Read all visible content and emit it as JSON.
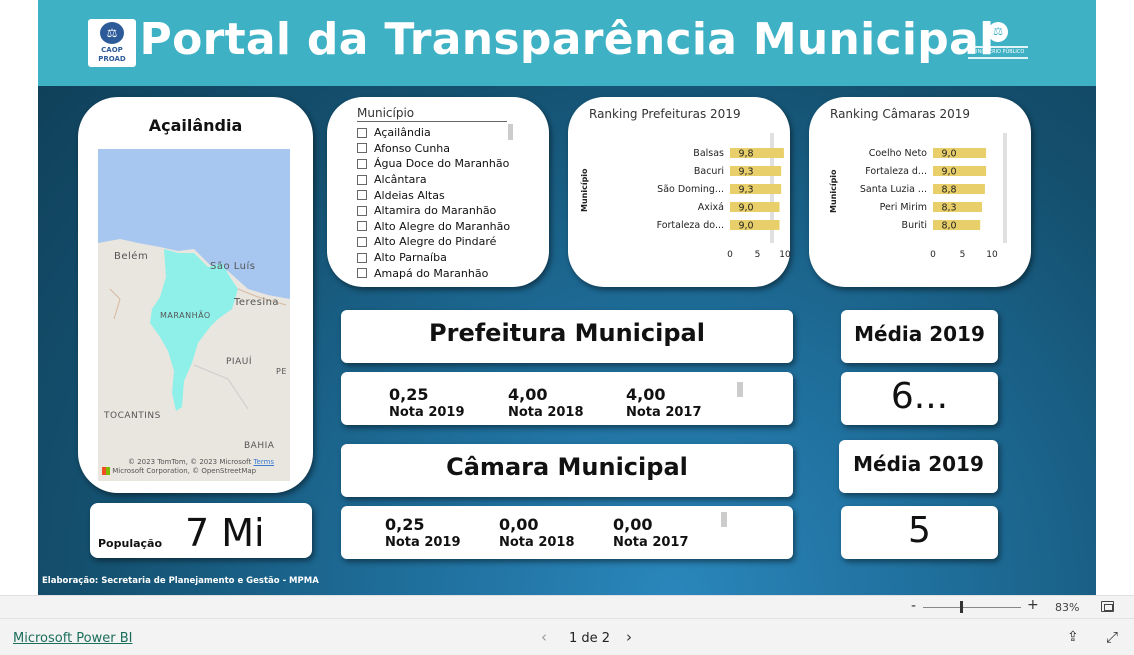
{
  "header": {
    "title": "Portal da Transparência Municipal",
    "logo_left_lines": [
      "CAOP",
      "PROAD"
    ],
    "logo_right_text": "MINISTÉRIO PÚBLICO"
  },
  "map_card": {
    "city": "Açailândia",
    "labels": {
      "belem": "Belém",
      "sao_luis": "São Luís",
      "teresina": "Teresina",
      "maranhao": "MARANHÃO",
      "piaui": "PIAUÍ",
      "pe": "PE",
      "tocantins": "TOCANTINS",
      "bahia": "BAHIA"
    },
    "credit_line1": "© 2023 TomTom, © 2023 Microsoft",
    "credit_terms": "Terms",
    "credit_line2": "Corporation, © OpenStreetMap",
    "credit_brand": "Microsoft"
  },
  "population": {
    "label": "População",
    "value": "7 Mi"
  },
  "slicer": {
    "title": "Município",
    "items": [
      "Açailândia",
      "Afonso Cunha",
      "Água Doce do Maranhão",
      "Alcântara",
      "Aldeias Altas",
      "Altamira do Maranhão",
      "Alto Alegre do Maranhão",
      "Alto Alegre do Pindaré",
      "Alto Parnaíba",
      "Amapá do Maranhão"
    ]
  },
  "ranking_prefeituras": {
    "title": "Ranking Prefeituras  2019",
    "y_axis_label": "Município"
  },
  "ranking_camaras": {
    "title": "Ranking Câmaras  2019",
    "y_axis_label": "Município"
  },
  "chart_data": [
    {
      "type": "bar",
      "orientation": "horizontal",
      "title": "Ranking Prefeituras  2019",
      "ylabel": "Município",
      "categories": [
        "Balsas",
        "Bacuri",
        "São Doming...",
        "Axixá",
        "Fortaleza do..."
      ],
      "values": [
        9.8,
        9.3,
        9.3,
        9.0,
        9.0
      ],
      "value_labels": [
        "9,8",
        "9,3",
        "9,3",
        "9,0",
        "9,0"
      ],
      "xlim": [
        0,
        10
      ],
      "xticks": [
        "0",
        "5",
        "10"
      ],
      "bar_color": "#e8cf6a"
    },
    {
      "type": "bar",
      "orientation": "horizontal",
      "title": "Ranking Câmaras  2019",
      "ylabel": "Município",
      "categories": [
        "Coelho Neto",
        "Fortaleza d...",
        "Santa Luzia ...",
        "Peri Mirim",
        "Buriti"
      ],
      "values": [
        9.0,
        9.0,
        8.8,
        8.3,
        8.0
      ],
      "value_labels": [
        "9,0",
        "9,0",
        "8,8",
        "8,3",
        "8,0"
      ],
      "xlim": [
        0,
        10
      ],
      "xticks": [
        "0",
        "5",
        "10"
      ],
      "bar_color": "#e8cf6a"
    }
  ],
  "prefeitura": {
    "title": "Prefeitura Municipal",
    "notes": [
      {
        "value": "0,25",
        "label": "Nota 2019"
      },
      {
        "value": "4,00",
        "label": "Nota 2018"
      },
      {
        "value": "4,00",
        "label": "Nota 2017"
      }
    ],
    "media_title": "Média 2019",
    "media_value": "6..."
  },
  "camara": {
    "title": "Câmara Municipal",
    "notes": [
      {
        "value": "0,25",
        "label": "Nota 2019"
      },
      {
        "value": "0,00",
        "label": "Nota 2018"
      },
      {
        "value": "0,00",
        "label": "Nota 2017"
      }
    ],
    "media_title": "Média 2019",
    "media_value": "5"
  },
  "credit": "Elaboração: Secretaria de Planejamento e Gestão - MPMA",
  "zoom": {
    "minus": "-",
    "plus": "+",
    "level": "83%",
    "level_fraction": 0.83
  },
  "footer": {
    "brand": "Microsoft Power BI",
    "page": "1 de 2",
    "prev": "‹",
    "next": "›"
  },
  "colors": {
    "header": "#3fb1c5",
    "background": "#14506f",
    "bar": "#e8cf6a",
    "map_region": "#8ff0ea",
    "map_water": "#a7c6f0",
    "footer_link": "#1b6e5a"
  }
}
